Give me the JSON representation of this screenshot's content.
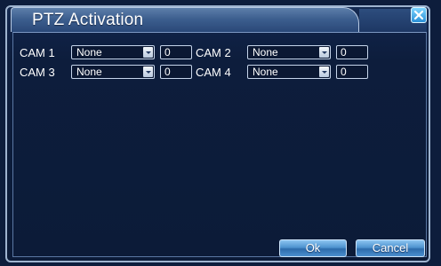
{
  "dialog": {
    "title": "PTZ Activation"
  },
  "cameras": [
    {
      "label": "CAM 1",
      "protocol": "None",
      "address": "0"
    },
    {
      "label": "CAM 2",
      "protocol": "None",
      "address": "0"
    },
    {
      "label": "CAM 3",
      "protocol": "None",
      "address": "0"
    },
    {
      "label": "CAM 4",
      "protocol": "None",
      "address": "0"
    }
  ],
  "buttons": {
    "ok": "Ok",
    "cancel": "Cancel"
  },
  "icons": {
    "close": "close-icon",
    "dropdown": "chevron-down-icon"
  },
  "colors": {
    "background": "#0d1d3c",
    "title_bar": "#3d5f8f",
    "button": "#4e93cf",
    "close_button": "#2a8fd6"
  }
}
